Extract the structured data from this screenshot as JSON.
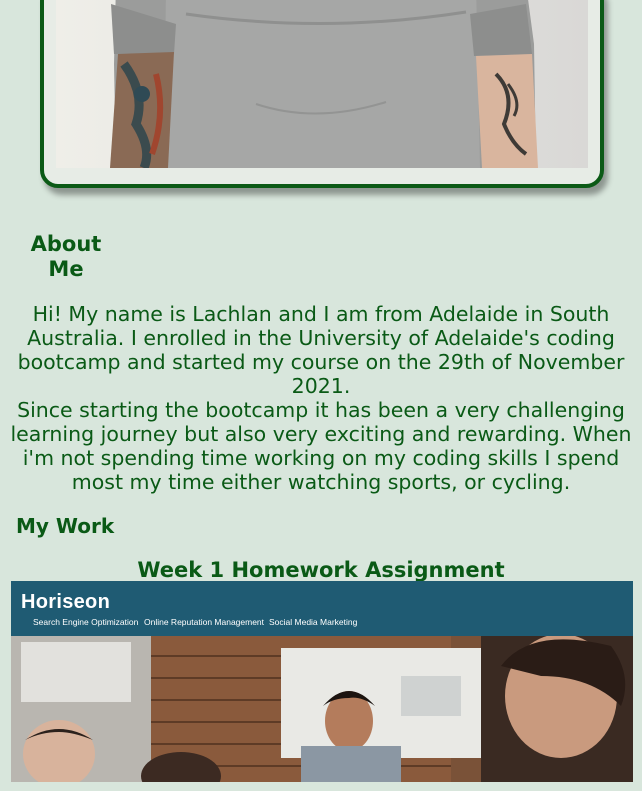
{
  "about": {
    "heading": "About Me",
    "paragraph_1": "Hi! My name is Lachlan and I am from Adelaide in South Australia. I enrolled in the University of Adelaide's coding bootcamp and started my course on the 29th of November 2021.",
    "paragraph_2": "Since starting the bootcamp it has been a very challenging learning journey but also very exciting and rewarding. When i'm not spending time working on my coding skills I spend most my time either watching sports, or cycling."
  },
  "work": {
    "heading": "My Work",
    "projects": [
      {
        "title": "Week 1 Homework Assignment",
        "preview": {
          "logo": "Horiseon",
          "nav": [
            "Search Engine Optimization",
            "Online Reputation Management",
            "Social Media Marketing"
          ]
        }
      }
    ]
  },
  "colors": {
    "background": "#d8e6dc",
    "text_green": "#0a5a16",
    "card_border": "#0b5a16",
    "preview_header": "#1f5b73"
  }
}
